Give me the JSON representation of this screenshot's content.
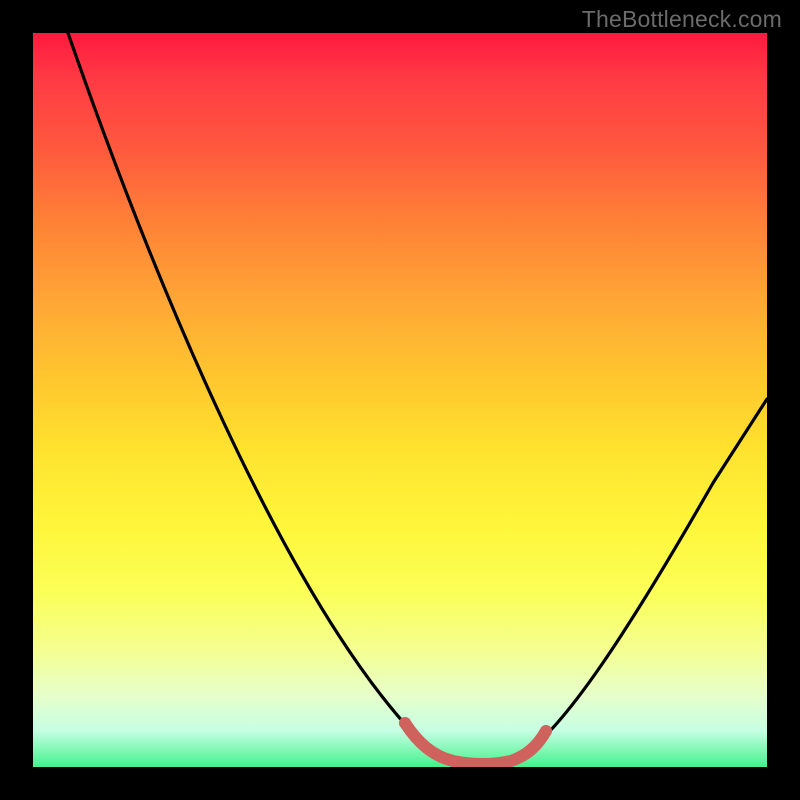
{
  "watermark": "TheBottleneck.com",
  "chart_data": {
    "type": "line",
    "title": "",
    "xlabel": "",
    "ylabel": "",
    "xlim": [
      0,
      100
    ],
    "ylim": [
      0,
      100
    ],
    "grid": false,
    "legend": false,
    "background": {
      "gradient_stops": [
        {
          "pct": 0,
          "color": "#ff1a3f"
        },
        {
          "pct": 16,
          "color": "#ff5a3e"
        },
        {
          "pct": 37,
          "color": "#ffa836"
        },
        {
          "pct": 57,
          "color": "#ffe32e"
        },
        {
          "pct": 76,
          "color": "#fbff56"
        },
        {
          "pct": 90,
          "color": "#e7ffc8"
        },
        {
          "pct": 100,
          "color": "#44f28c"
        }
      ]
    },
    "series": [
      {
        "name": "bottleneck-curve",
        "color": "#000000",
        "x": [
          5,
          10,
          15,
          20,
          25,
          30,
          35,
          40,
          45,
          50,
          53,
          56,
          60,
          64,
          67,
          70,
          75,
          80,
          85,
          90,
          95,
          100
        ],
        "y": [
          100,
          89,
          78,
          67,
          56,
          46,
          37,
          28,
          20,
          12,
          6,
          2,
          0,
          0,
          1,
          4,
          10,
          18,
          26,
          34,
          42,
          50
        ]
      },
      {
        "name": "optimal-band",
        "color": "#d0625e",
        "thickness": "bold",
        "x": [
          52,
          54,
          56,
          58,
          60,
          62,
          64,
          66,
          68,
          69
        ],
        "y": [
          5,
          2.5,
          1.2,
          0.5,
          0.2,
          0.2,
          0.4,
          1.0,
          2.2,
          3.8
        ]
      }
    ],
    "minimum": {
      "x": 62,
      "y": 0
    }
  }
}
